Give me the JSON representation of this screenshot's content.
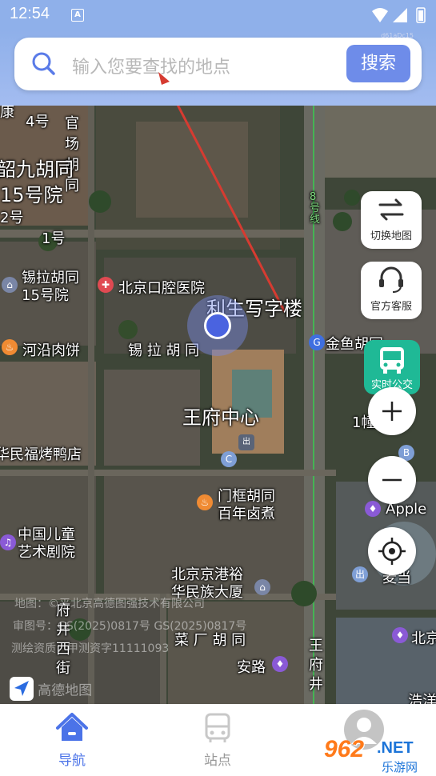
{
  "status_bar": {
    "time": "12:54",
    "notification_icon": "A"
  },
  "search": {
    "placeholder": "输入您要查找的地点",
    "button_label": "搜索",
    "build_tag": "d61aDc15"
  },
  "map": {
    "labels": {
      "four_hao": "4号",
      "guan": "官",
      "chang": "场",
      "hu": "胡",
      "tong_v": "同",
      "shao_jiu": "韶九胡同",
      "five_hao_yuan": "15号院",
      "two_hao": "2号",
      "one_hao": "1号",
      "line8": "8号线",
      "xila_15": "锡拉胡同\n15号院",
      "dental": "北京口腔医院",
      "liyuan": "利生写字楼",
      "jinyu": "金鱼胡同",
      "heyan": "河沿肉饼",
      "xila_hutong": "锡 拉 胡 同",
      "wangfu_center": "王府中心",
      "minfu": "华民福烤鸭店",
      "menkuang": "门框胡同\n百年卤煮",
      "apple": "Apple",
      "children_theatre": "中国儿童\n艺术剧院",
      "gangao": "北京京港裕\n华民族大厦",
      "caichang": "菜 厂 胡 同",
      "an_lu": "安路",
      "wangfujing_v": "王\n府\n井",
      "fujing_west": "府\n井\n西\n街",
      "maidang": "麦当",
      "bei": "北京",
      "haoyun": "浩洋",
      "one_ge": "1幢",
      "kang": "康",
      "chu": "出",
      "c_badge": "C",
      "b_badge": "B"
    },
    "watermark": [
      "地图：©平北京高德图强技术有限公司",
      "审图号：GS(2025)0817号 GS(2025)0817号",
      "测绘资质：甲测资字11111093"
    ],
    "logo_text": "高德地图"
  },
  "controls": {
    "switch_map": "切换地图",
    "customer_service": "官方客服",
    "realtime_bus": "实时公交",
    "zoom_in": "+",
    "zoom_out": "−"
  },
  "tabs": [
    {
      "label": "导航",
      "active": true
    },
    {
      "label": "站点",
      "active": false
    },
    {
      "label": "",
      "active": false
    }
  ],
  "brand": {
    "number": "962",
    "dot_net": ".NET",
    "site": "乐游网"
  },
  "colors": {
    "accent": "#6e8ce9",
    "tab_active": "#4b73e8",
    "bus_green": "#1fb996"
  }
}
